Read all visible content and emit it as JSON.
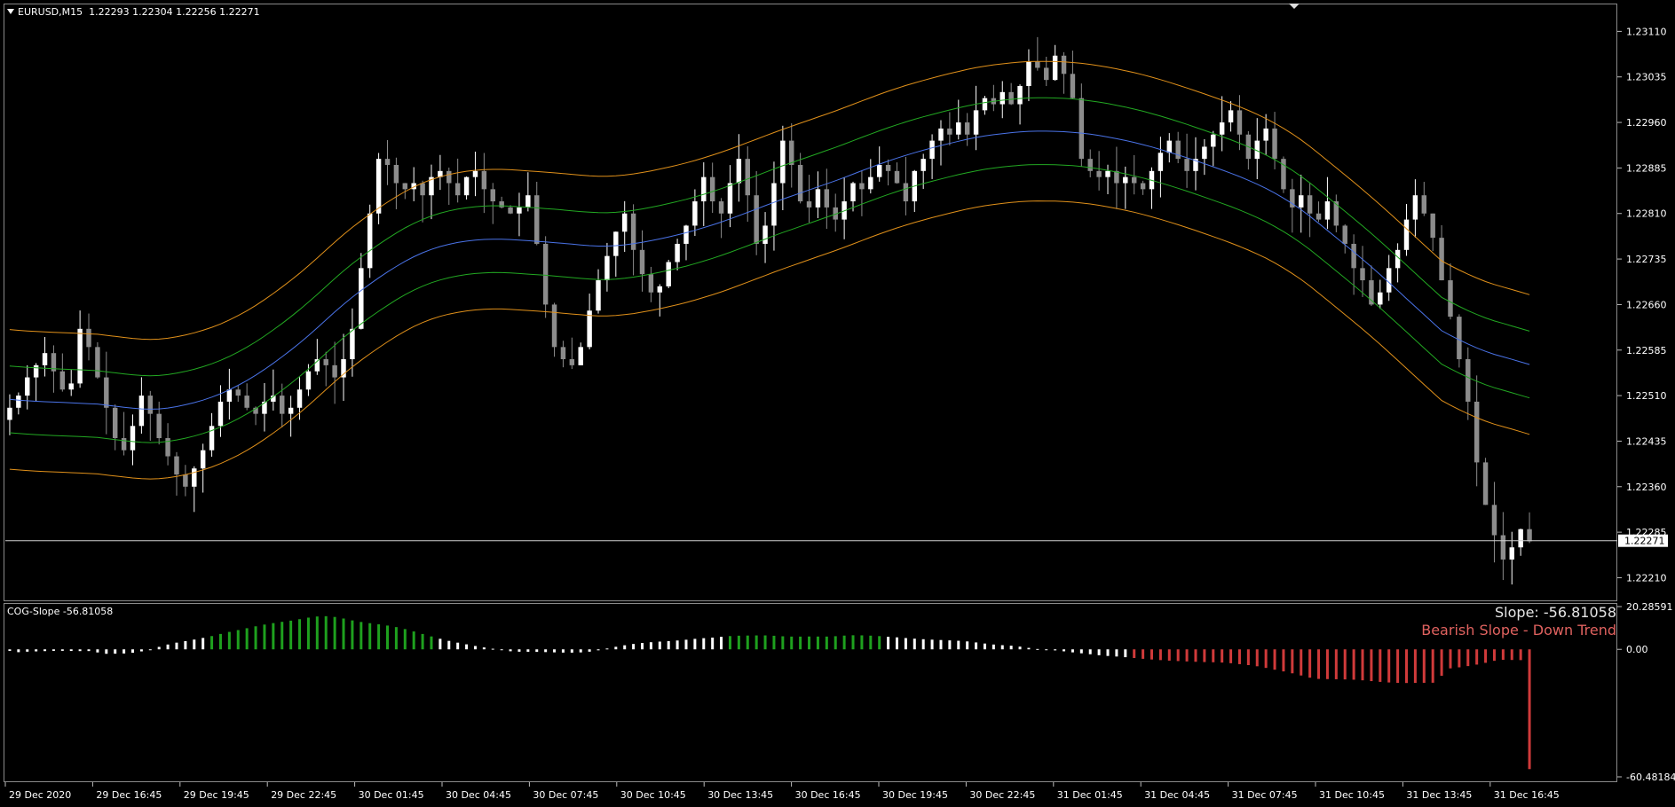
{
  "symbol_title": "EURUSD,M15  1.22293 1.22304 1.22256 1.22271",
  "indicator": {
    "title": "COG-Slope -56.81058",
    "slope_text": "Slope: -56.81058",
    "trend_text": "Bearish Slope - Down Trend"
  },
  "price_axis": {
    "ticks": [
      "1.23110",
      "1.23035",
      "1.22960",
      "1.22885",
      "1.22810",
      "1.22735",
      "1.22660",
      "1.22585",
      "1.22510",
      "1.22435",
      "1.22360",
      "1.22285",
      "1.22210"
    ],
    "current_price": "1.22271"
  },
  "indicator_axis": {
    "ticks": [
      "20.28591",
      "0.00",
      "-60.48184"
    ]
  },
  "time_axis": {
    "ticks": [
      "29 Dec 2020",
      "29 Dec 16:45",
      "29 Dec 19:45",
      "29 Dec 22:45",
      "30 Dec 01:45",
      "30 Dec 04:45",
      "30 Dec 07:45",
      "30 Dec 10:45",
      "30 Dec 13:45",
      "30 Dec 16:45",
      "30 Dec 19:45",
      "30 Dec 22:45",
      "31 Dec 01:45",
      "31 Dec 04:45",
      "31 Dec 07:45",
      "31 Dec 10:45",
      "31 Dec 13:45",
      "31 Dec 16:45"
    ]
  },
  "colors": {
    "background": "#000000",
    "bull_candle": "#ffffff",
    "bear_candle": "#8c8c8c",
    "center_line": "#4a73e8",
    "inner_band": "#22a822",
    "outer_band": "#e0901a",
    "hist_bull": "#1ea01e",
    "hist_neutral": "#ffffff",
    "hist_bear": "#d03a3a",
    "grid_text": "#ffffff"
  },
  "chart_data": {
    "type": "candlestick",
    "price_range": [
      1.2218,
      1.2315
    ],
    "close_series": [
      1.2249,
      1.2251,
      1.2254,
      1.2256,
      1.2258,
      1.2255,
      1.2252,
      1.2253,
      1.2262,
      1.2259,
      1.2254,
      1.2249,
      1.2244,
      1.2242,
      1.2246,
      1.2251,
      1.2248,
      1.2244,
      1.2241,
      1.2238,
      1.2236,
      1.2239,
      1.2242,
      1.2246,
      1.225,
      1.2252,
      1.2251,
      1.2249,
      1.2248,
      1.225,
      1.2251,
      1.2248,
      1.2249,
      1.2252,
      1.2255,
      1.2257,
      1.2256,
      1.2254,
      1.2257,
      1.2262,
      1.2272,
      1.2281,
      1.229,
      1.2289,
      1.2286,
      1.2285,
      1.2286,
      1.2284,
      1.2287,
      1.2288,
      1.2286,
      1.2284,
      1.2287,
      1.2288,
      1.2285,
      1.2283,
      1.2282,
      1.2281,
      1.2282,
      1.2284,
      1.2276,
      1.2266,
      1.2259,
      1.2257,
      1.2256,
      1.2259,
      1.2265,
      1.227,
      1.2274,
      1.2278,
      1.2281,
      1.2275,
      1.2271,
      1.2268,
      1.2269,
      1.2273,
      1.2276,
      1.2279,
      1.2283,
      1.2287,
      1.2283,
      1.2281,
      1.2286,
      1.229,
      1.2284,
      1.2276,
      1.2279,
      1.2286,
      1.2293,
      1.2289,
      1.2283,
      1.2282,
      1.2285,
      1.2282,
      1.228,
      1.2283,
      1.2286,
      1.2285,
      1.2287,
      1.2289,
      1.2288,
      1.2286,
      1.2283,
      1.2288,
      1.229,
      1.2293,
      1.2295,
      1.2294,
      1.2296,
      1.2294,
      1.2298,
      1.23,
      1.2299,
      1.2301,
      1.2299,
      1.2302,
      1.2306,
      1.2305,
      1.2303,
      1.2307,
      1.2304,
      1.23,
      1.229,
      1.2288,
      1.2287,
      1.2288,
      1.2286,
      1.2287,
      1.2286,
      1.2285,
      1.2288,
      1.2291,
      1.2293,
      1.229,
      1.2288,
      1.229,
      1.2292,
      1.2294,
      1.2296,
      1.2298,
      1.2294,
      1.229,
      1.2293,
      1.2295,
      1.229,
      1.2285,
      1.2282,
      1.2284,
      1.2281,
      1.228,
      1.2283,
      1.2279,
      1.2276,
      1.2272,
      1.227,
      1.2266,
      1.2268,
      1.2272,
      1.2275,
      1.228,
      1.2284,
      1.2281,
      1.2277,
      1.227,
      1.2264,
      1.2257,
      1.225,
      1.224,
      1.2233,
      1.2228,
      1.2224,
      1.2226,
      1.2229,
      1.2227
    ],
    "indicator_histogram": {
      "range": [
        -60.48184,
        20.28591
      ],
      "last_value": -56.81058
    }
  }
}
